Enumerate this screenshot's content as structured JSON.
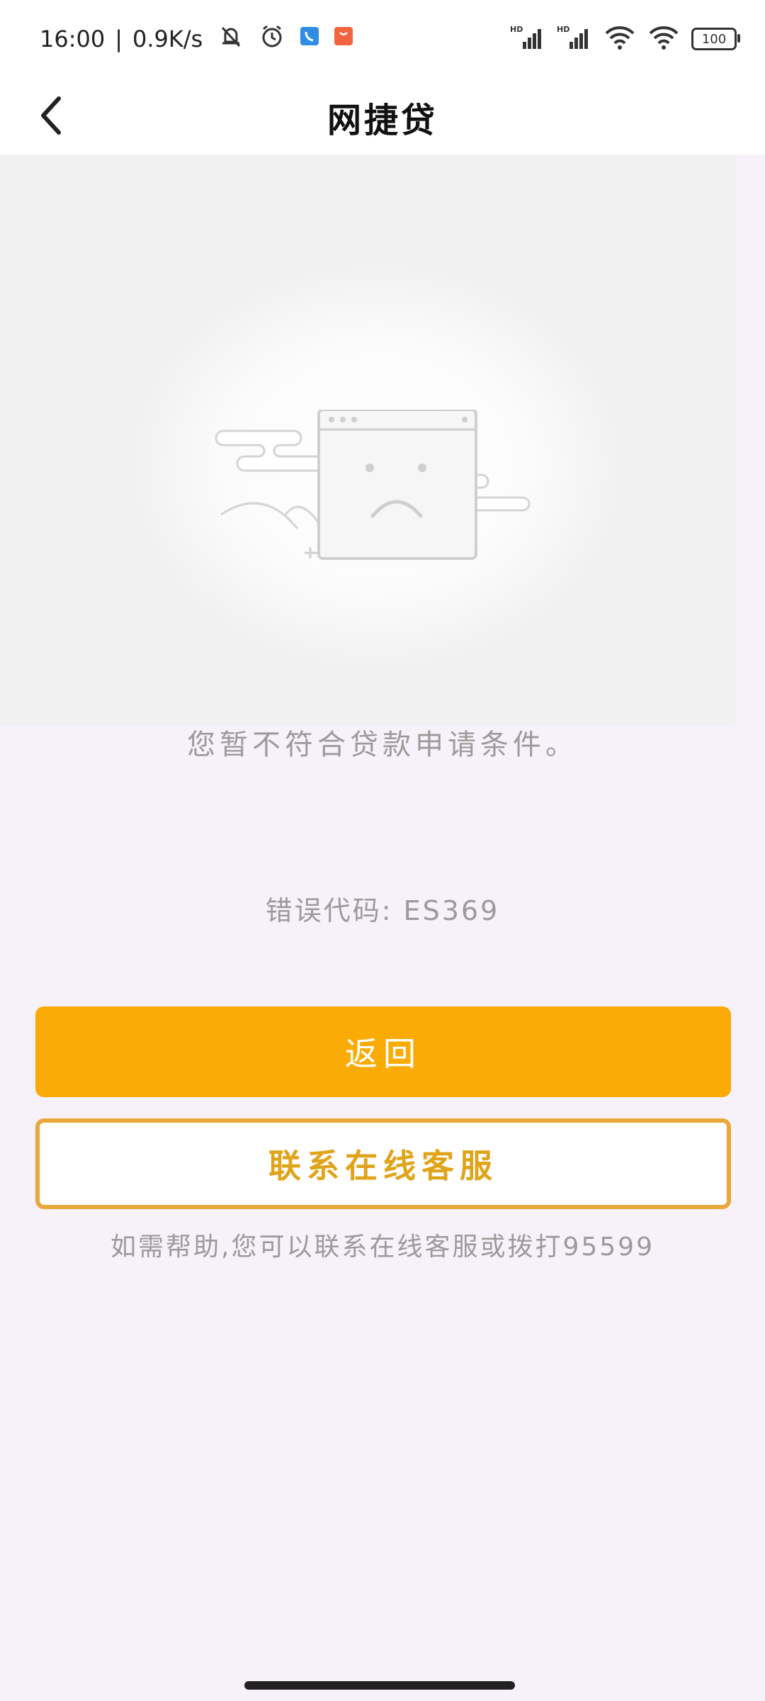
{
  "status_bar": {
    "time": "16:00",
    "separator": "|",
    "network_speed": "0.9K/s",
    "left_icons": [
      "mute-bell-icon",
      "alarm-icon",
      "phone-app-icon",
      "store-app-icon"
    ],
    "right_icons": [
      "hd-signal-icon",
      "hd-signal-icon",
      "wifi-icon",
      "wifi-icon",
      "battery-icon"
    ],
    "hd_label": "HD",
    "battery_level": "100"
  },
  "nav": {
    "title": "网捷贷"
  },
  "content": {
    "message": "您暂不符合贷款申请条件。",
    "error_code": "错误代码: ES369",
    "return_button": "返回",
    "service_button": "联系在线客服",
    "help_text": "如需帮助,您可以联系在线客服或拨打95599"
  },
  "colors": {
    "primary_button": "#fbab05",
    "outline_button": "#e9a83a",
    "page_background": "#f7f1f9"
  }
}
